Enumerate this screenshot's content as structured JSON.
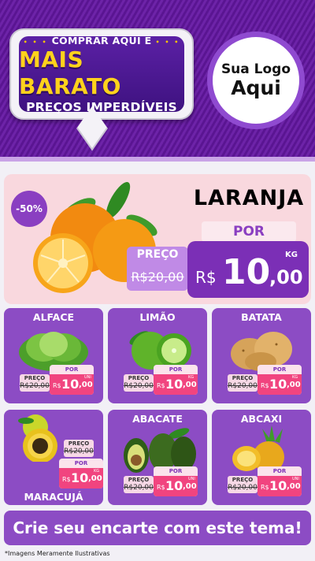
{
  "header": {
    "bubble_top": "COMPRAR AQUI É",
    "bubble_main": "MAIS BARATO",
    "bubble_sub": "PREÇOS IMPERDÍVEIS",
    "logo_line1": "Sua Logo",
    "logo_line2": "Aqui"
  },
  "featured": {
    "discount": "-50%",
    "name": "LARANJA",
    "por_label": "POR",
    "preco_label": "PREÇO",
    "old_price": "R$20,00",
    "currency": "R$",
    "price_int": "10",
    "price_dec": ",00",
    "unit": "KG"
  },
  "products": [
    {
      "name": "ALFACE",
      "preco_label": "PREÇO",
      "old_price": "R$20,00",
      "por_label": "POR",
      "currency": "R$",
      "price_int": "10",
      "price_dec": ",00",
      "unit": "UNI"
    },
    {
      "name": "LIMÃO",
      "preco_label": "PREÇO",
      "old_price": "R$20,00",
      "por_label": "POR",
      "currency": "R$",
      "price_int": "10",
      "price_dec": ",00",
      "unit": "KG"
    },
    {
      "name": "BATATA",
      "preco_label": "PREÇO",
      "old_price": "R$20,00",
      "por_label": "POR",
      "currency": "R$",
      "price_int": "10",
      "price_dec": ",00",
      "unit": "KG"
    },
    {
      "name": "MARACUJÁ",
      "preco_label": "PREÇO",
      "old_price": "R$20,00",
      "por_label": "POR",
      "currency": "R$",
      "price_int": "10",
      "price_dec": ",00",
      "unit": "KG"
    },
    {
      "name": "ABACATE",
      "preco_label": "PREÇO",
      "old_price": "R$20,00",
      "por_label": "POR",
      "currency": "R$",
      "price_int": "10",
      "price_dec": ",00",
      "unit": "UNI"
    },
    {
      "name": "ABCAXI",
      "preco_label": "PREÇO",
      "old_price": "R$20,00",
      "por_label": "POR",
      "currency": "R$",
      "price_int": "10",
      "price_dec": ",00",
      "unit": "UNI"
    }
  ],
  "banner": "Crie seu encarte com este tema!",
  "footnote": "*Imagens Meramente Ilustrativas",
  "colors": {
    "purple": "#8c4cc4",
    "dark_purple": "#5a1592",
    "yellow": "#ffd21c",
    "pink": "#f1447f",
    "hero_bg": "#f9d8de"
  }
}
